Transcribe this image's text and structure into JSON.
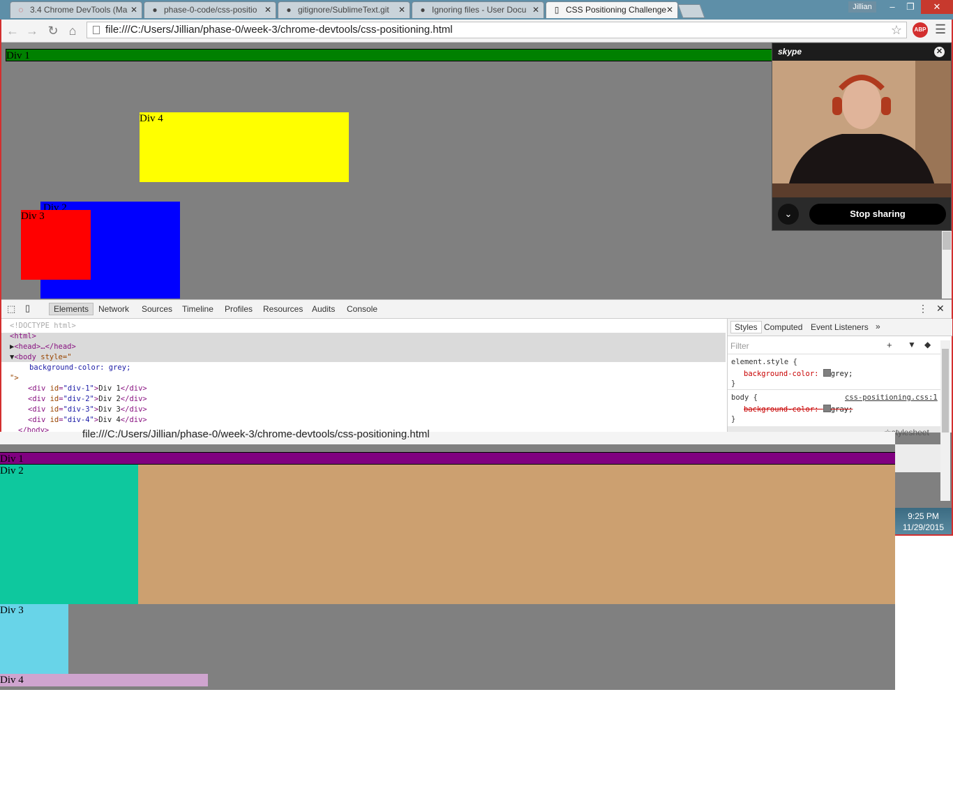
{
  "browser": {
    "tabs": [
      {
        "title": "3.4 Chrome DevTools (Ma",
        "icon": "loading-icon"
      },
      {
        "title": "phase-0-code/css-positio",
        "icon": "github-icon"
      },
      {
        "title": "gitignore/SublimeText.git",
        "icon": "github-icon"
      },
      {
        "title": "Ignoring files - User Docu",
        "icon": "github-icon"
      },
      {
        "title": "CSS Positioning Challenge",
        "icon": "page-icon"
      }
    ],
    "user": "Jillian",
    "url": "file:///C:/Users/Jillian/phase-0/week-3/chrome-devtools/css-positioning.html",
    "extension": "ABP"
  },
  "page1": {
    "div1": "Div 1",
    "div2": "Div 2",
    "div3": "Div 3",
    "div4": "Div 4"
  },
  "skype": {
    "logo": "skype",
    "stop_sharing": "Stop sharing"
  },
  "devtools": {
    "tabs": [
      "Elements",
      "Network",
      "Sources",
      "Timeline",
      "Profiles",
      "Resources",
      "Audits",
      "Console"
    ],
    "dom": {
      "doctype": "<!DOCTYPE html>",
      "html_open": "<html>",
      "head": "<head>…</head>",
      "body_open_tag": "<body",
      "body_attr": "style",
      "body_eq": "=\"",
      "body_style": "background-color: grey;",
      "body_close_quote": "\">",
      "rows": [
        {
          "id": "div-1",
          "text": "Div 1"
        },
        {
          "id": "div-2",
          "text": "Div 2"
        },
        {
          "id": "div-3",
          "text": "Div 3"
        },
        {
          "id": "div-4",
          "text": "Div 4"
        }
      ],
      "body_close": "</body>"
    },
    "styles": {
      "tabs": [
        "Styles",
        "Computed",
        "Event Listeners"
      ],
      "filter_placeholder": "Filter",
      "element_style_selector": "element.style {",
      "element_style_prop": "background-color:",
      "element_style_val": "grey;",
      "close_brace": "}",
      "body_selector": "body {",
      "body_source": "css-positioning.css:1",
      "body_prop": "background-color:",
      "body_val": "gray;",
      "stylesheet": "stylesheet"
    }
  },
  "page2": {
    "url": "file:///C:/Users/Jillian/phase-0/week-3/chrome-devtools/css-positioning.html",
    "div1": "Div 1",
    "div2": "Div 2",
    "div3": "Div 3",
    "div4": "Div 4"
  },
  "taskbar": {
    "time": "9:25 PM",
    "date": "11/29/2015"
  },
  "colors": {
    "page_bg": "#808080",
    "div1_top": "#008000",
    "div2_top": "#0000ff",
    "div3_top": "#ff0000",
    "div4_top": "#ffff00",
    "div1_bottom": "#800080",
    "div2_bottom": "#0ec89e",
    "div2_bottom_rest": "#cca070",
    "div3_bottom": "#68d4e8",
    "div4_bottom": "#cfa4cf"
  }
}
